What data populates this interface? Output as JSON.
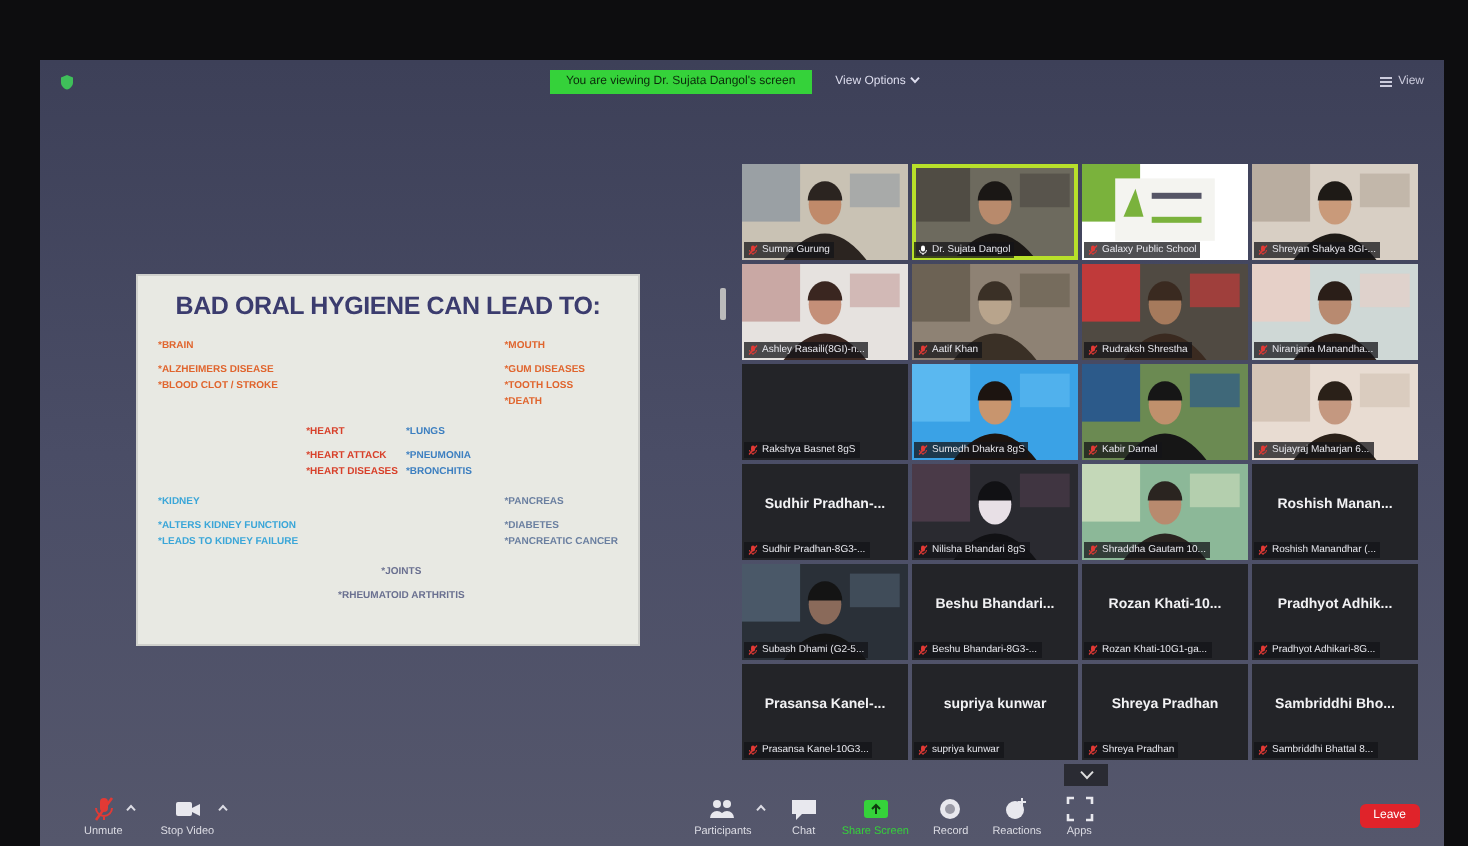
{
  "top_bar": {
    "banner": "You are viewing Dr. Sujata Dangol's screen",
    "view_options": "View Options",
    "view": "View"
  },
  "slide": {
    "title": "BAD ORAL HYGIENE CAN LEAD TO:",
    "groups": [
      {
        "heading": "*BRAIN",
        "items": [
          "*ALZHEIMERS DISEASE",
          "*BLOOD CLOT / STROKE"
        ],
        "color": "#e0652e"
      },
      {
        "heading": "*MOUTH",
        "items": [
          "*GUM DISEASES",
          "*TOOTH LOSS",
          "*DEATH"
        ],
        "color": "#e0652e"
      },
      {
        "heading": "*HEART",
        "items": [
          "*HEART ATTACK",
          "*HEART DISEASES"
        ],
        "color": "#d8402a"
      },
      {
        "heading": "*LUNGS",
        "items": [
          "*PNEUMONIA",
          "*BRONCHITIS"
        ],
        "color": "#3c7fc0"
      },
      {
        "heading": "*KIDNEY",
        "items": [
          "*ALTERS KIDNEY FUNCTION",
          "*LEADS TO KIDNEY FAILURE"
        ],
        "color": "#3aa6d8"
      },
      {
        "heading": "*PANCREAS",
        "items": [
          "*DIABETES",
          "*PANCREATIC CANCER"
        ],
        "color": "#6a7fa0"
      },
      {
        "heading": "*JOINTS",
        "items": [
          "*RHEUMATOID ARTHRITIS"
        ],
        "color": "#6a7090"
      }
    ]
  },
  "tiles": [
    {
      "kind": "video",
      "name": "Sumna Gurung",
      "muted": true,
      "speaking": false
    },
    {
      "kind": "video",
      "name": "Dr. Sujata Dangol",
      "muted": false,
      "speaking": true
    },
    {
      "kind": "video",
      "name": "Galaxy Public School",
      "muted": true,
      "speaking": false
    },
    {
      "kind": "video",
      "name": "Shreyan Shakya 8GI-...",
      "muted": true,
      "speaking": false
    },
    {
      "kind": "video",
      "name": "Ashley Rasaili(8GI)-n...",
      "muted": true,
      "speaking": false
    },
    {
      "kind": "video",
      "name": "Aatif Khan",
      "muted": true,
      "speaking": false
    },
    {
      "kind": "video",
      "name": "Rudraksh Shrestha",
      "muted": true,
      "speaking": false
    },
    {
      "kind": "video",
      "name": "Niranjana Manandha...",
      "muted": true,
      "speaking": false
    },
    {
      "kind": "blank",
      "name": "Rakshya Basnet 8gS",
      "muted": true,
      "speaking": false
    },
    {
      "kind": "video",
      "name": "Sumedh Dhakra 8gS",
      "muted": true,
      "speaking": false
    },
    {
      "kind": "video",
      "name": "Kabir Darnal",
      "muted": true,
      "speaking": false
    },
    {
      "kind": "video",
      "name": "Sujayraj Maharjan 6...",
      "muted": true,
      "speaking": false
    },
    {
      "kind": "name",
      "display_name": "Sudhir Pradhan-...",
      "name": "Sudhir Pradhan-8G3-...",
      "muted": true,
      "speaking": false
    },
    {
      "kind": "video",
      "name": "Nilisha Bhandari 8gS",
      "muted": true,
      "speaking": false
    },
    {
      "kind": "video",
      "name": "Shraddha Gautam 10...",
      "muted": true,
      "speaking": false
    },
    {
      "kind": "name",
      "display_name": "Roshish Manan...",
      "name": "Roshish Manandhar (...",
      "muted": true,
      "speaking": false
    },
    {
      "kind": "video",
      "name": "Subash Dhami (G2-5...",
      "muted": true,
      "speaking": false
    },
    {
      "kind": "name",
      "display_name": "Beshu Bhandari...",
      "name": "Beshu Bhandari-8G3-...",
      "muted": true,
      "speaking": false
    },
    {
      "kind": "name",
      "display_name": "Rozan Khati-10...",
      "name": "Rozan Khati-10G1-ga...",
      "muted": true,
      "speaking": false
    },
    {
      "kind": "name",
      "display_name": "Pradhyot Adhik...",
      "name": "Pradhyot Adhikari-8G...",
      "muted": true,
      "speaking": false
    },
    {
      "kind": "name",
      "display_name": "Prasansa Kanel-...",
      "name": "Prasansa Kanel-10G3...",
      "muted": true,
      "speaking": false
    },
    {
      "kind": "name",
      "display_name": "supriya kunwar",
      "name": "supriya kunwar",
      "muted": true,
      "speaking": false
    },
    {
      "kind": "name",
      "display_name": "Shreya Pradhan",
      "name": "Shreya Pradhan",
      "muted": true,
      "speaking": false
    },
    {
      "kind": "name",
      "display_name": "Sambriddhi Bho...",
      "name": "Sambriddhi Bhattal 8...",
      "muted": true,
      "speaking": false
    }
  ],
  "toolbar": {
    "left": [
      {
        "kind": "mic-muted",
        "label": "Unmute",
        "caret": true
      },
      {
        "kind": "camera",
        "label": "Stop Video",
        "caret": true
      }
    ],
    "center": [
      {
        "kind": "participants",
        "label": "Participants",
        "caret": true
      },
      {
        "kind": "chat",
        "label": "Chat",
        "caret": false
      },
      {
        "kind": "share",
        "label": "Share Screen",
        "caret": false
      },
      {
        "kind": "record",
        "label": "Record",
        "caret": false
      },
      {
        "kind": "reactions",
        "label": "Reactions",
        "caret": false
      },
      {
        "kind": "apps",
        "label": "Apps",
        "caret": false
      }
    ],
    "leave": "Leave"
  }
}
